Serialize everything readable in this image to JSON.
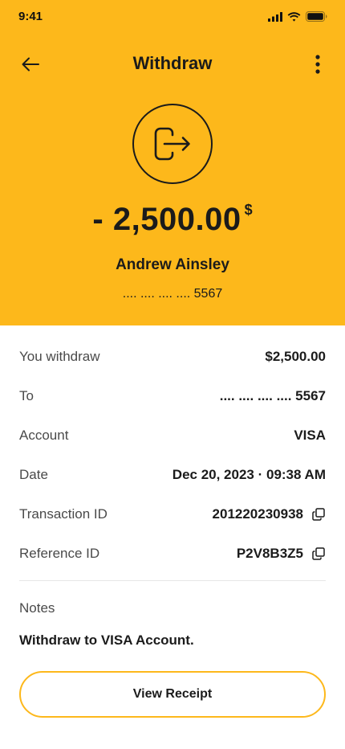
{
  "status_bar": {
    "time": "9:41"
  },
  "header": {
    "title": "Withdraw"
  },
  "icons": {
    "back": "arrow-left-icon",
    "more": "more-vertical-icon",
    "transaction": "logout-icon",
    "copy": "copy-icon"
  },
  "summary": {
    "amount": "- 2,500.00",
    "currency": "$",
    "name": "Andrew Ainsley",
    "card_masked": ".... .... .... .... 5567"
  },
  "details": [
    {
      "label": "You withdraw",
      "value": "$2,500.00"
    },
    {
      "label": "To",
      "value": ".... .... .... .... 5567"
    },
    {
      "label": "Account",
      "value": "VISA"
    },
    {
      "label": "Date",
      "value": "Dec 20, 2023 · 09:38 AM"
    },
    {
      "label": "Transaction ID",
      "value": "201220230938"
    },
    {
      "label": "Reference ID",
      "value": "P2V8B3Z5"
    }
  ],
  "notes": {
    "label": "Notes",
    "text": "Withdraw to VISA Account."
  },
  "actions": {
    "view_receipt": "View Receipt"
  },
  "colors": {
    "accent": "#fdb81b",
    "text": "#1b1b1b",
    "muted": "#4a4a4a",
    "divider": "#e6e6e6"
  }
}
